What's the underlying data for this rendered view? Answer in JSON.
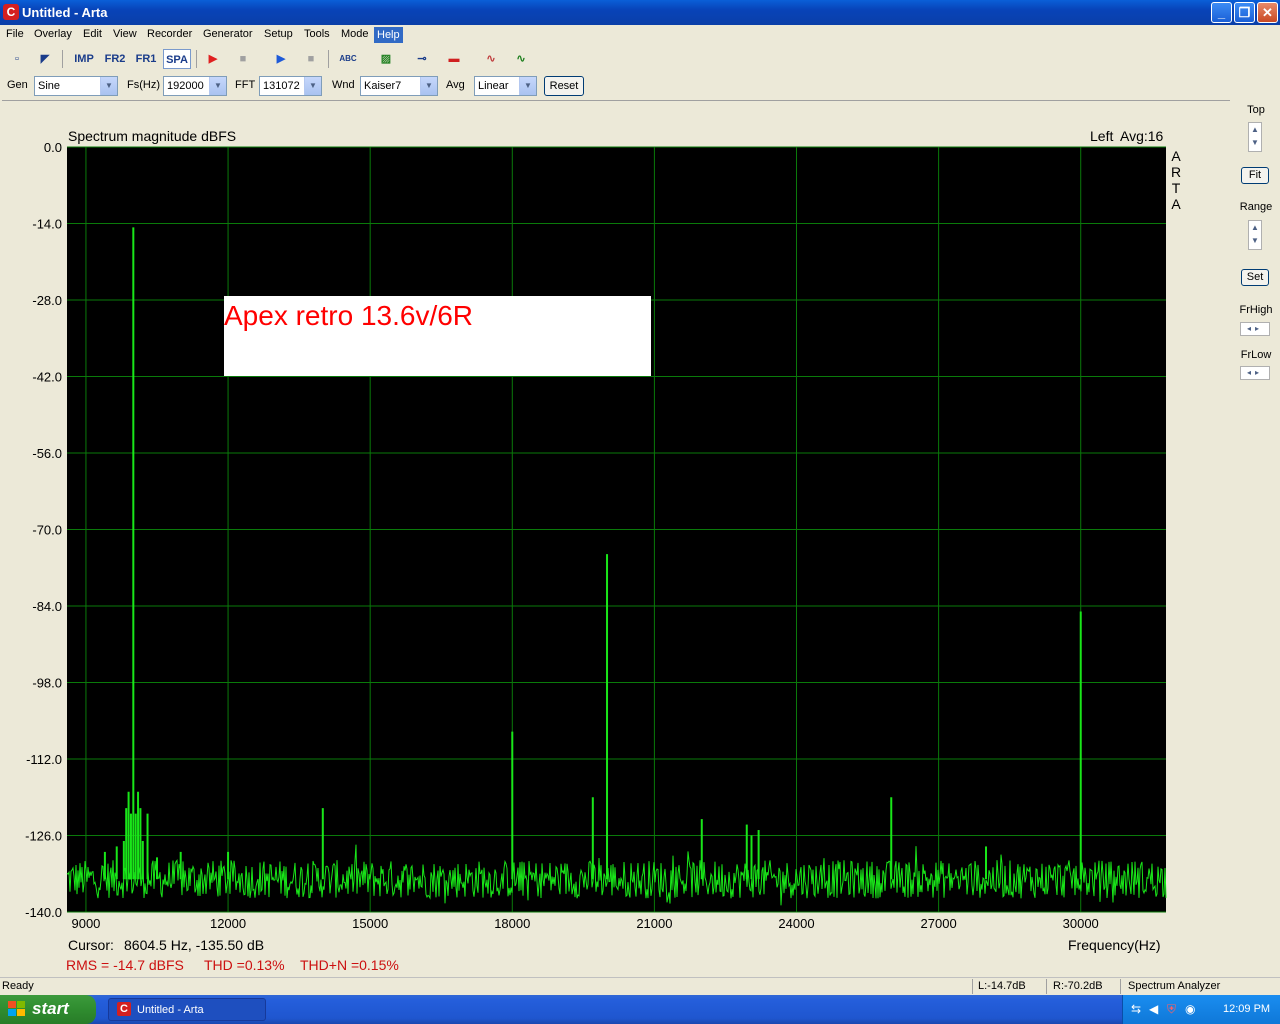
{
  "window": {
    "title": "Untitled - Arta",
    "app_icon": "C"
  },
  "menu": [
    "File",
    "Overlay",
    "Edit",
    "View",
    "Recorder",
    "Generator",
    "Setup",
    "Tools",
    "Mode",
    "Help"
  ],
  "toolbar": {
    "imp": "IMP",
    "fr2": "FR2",
    "fr1": "FR1",
    "spa": "SPA",
    "abc": "ABC"
  },
  "controls": {
    "gen_label": "Gen",
    "gen_value": "Sine",
    "fs_label": "Fs(Hz)",
    "fs_value": "192000",
    "fft_label": "FFT",
    "fft_value": "131072",
    "wnd_label": "Wnd",
    "wnd_value": "Kaiser7",
    "avg_label": "Avg",
    "avg_value": "Linear",
    "reset": "Reset"
  },
  "plot": {
    "title": "Spectrum magnitude dBFS",
    "channel": "Left",
    "avg": "Avg:16",
    "side_letters": [
      "A",
      "R",
      "T",
      "A"
    ],
    "annotation": "Apex retro 13.6v/6R",
    "cursor_label": "Cursor:",
    "cursor_value": "8604.5 Hz, -135.50 dB",
    "freq_label": "Frequency(Hz)",
    "rms": "RMS =  -14.7 dBFS",
    "thd": "THD =0.13%",
    "thdn": "THD+N =0.15%",
    "y_ticks": [
      "0.0",
      "-14.0",
      "-28.0",
      "-42.0",
      "-56.0",
      "-70.0",
      "-84.0",
      "-98.0",
      "-112.0",
      "-126.0",
      "-140.0"
    ],
    "x_ticks": [
      "9000",
      "12000",
      "15000",
      "18000",
      "21000",
      "24000",
      "27000",
      "30000"
    ]
  },
  "chart_data": {
    "type": "line",
    "title": "Spectrum magnitude dBFS",
    "xlabel": "Frequency(Hz)",
    "ylabel": "",
    "xlim": [
      8600,
      31800
    ],
    "ylim": [
      -140,
      0
    ],
    "xticks": [
      9000,
      12000,
      15000,
      18000,
      21000,
      24000,
      27000,
      30000
    ],
    "yticks": [
      0,
      -14,
      -28,
      -42,
      -56,
      -70,
      -84,
      -98,
      -112,
      -126,
      -140
    ],
    "grid": true,
    "line_color": "#00ff00",
    "background": "#000000",
    "noise_floor_db": -134,
    "peaks": [
      {
        "hz": 9400,
        "db": -129
      },
      {
        "hz": 9650,
        "db": -128
      },
      {
        "hz": 9800,
        "db": -127
      },
      {
        "hz": 9850,
        "db": -121
      },
      {
        "hz": 9900,
        "db": -118
      },
      {
        "hz": 9950,
        "db": -122
      },
      {
        "hz": 10000,
        "db": -14.7
      },
      {
        "hz": 10050,
        "db": -122
      },
      {
        "hz": 10100,
        "db": -118
      },
      {
        "hz": 10150,
        "db": -121
      },
      {
        "hz": 10200,
        "db": -127
      },
      {
        "hz": 10300,
        "db": -122
      },
      {
        "hz": 10500,
        "db": -130
      },
      {
        "hz": 11000,
        "db": -129
      },
      {
        "hz": 12000,
        "db": -129
      },
      {
        "hz": 14000,
        "db": -121
      },
      {
        "hz": 18000,
        "db": -107
      },
      {
        "hz": 19700,
        "db": -119
      },
      {
        "hz": 20000,
        "db": -74.5
      },
      {
        "hz": 22000,
        "db": -123
      },
      {
        "hz": 22950,
        "db": -124
      },
      {
        "hz": 23050,
        "db": -126
      },
      {
        "hz": 23200,
        "db": -125
      },
      {
        "hz": 26000,
        "db": -119
      },
      {
        "hz": 28000,
        "db": -128
      },
      {
        "hz": 30000,
        "db": -85
      }
    ]
  },
  "sidebar": {
    "top": "Top",
    "fit": "Fit",
    "range": "Range",
    "set": "Set",
    "frhigh": "FrHigh",
    "frlow": "FrLow"
  },
  "status": {
    "ready": "Ready",
    "l": "L:-14.7dB",
    "r": "R:-70.2dB",
    "mode": "Spectrum Analyzer"
  },
  "taskbar": {
    "start": "start",
    "item": "Untitled - Arta",
    "clock": "12:09 PM"
  }
}
